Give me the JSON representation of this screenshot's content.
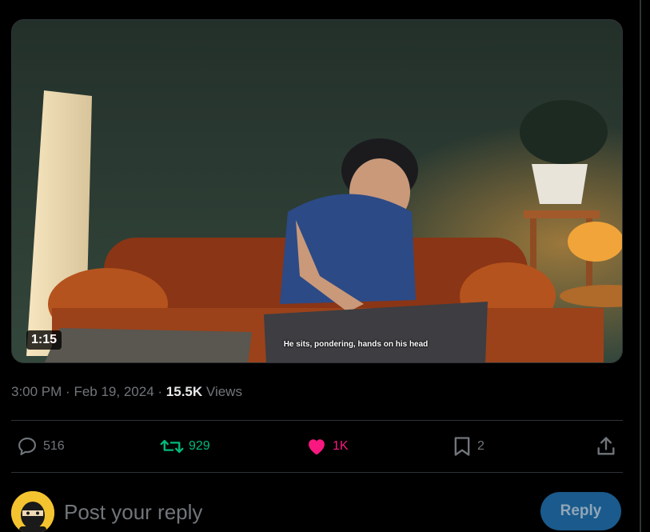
{
  "video": {
    "duration": "1:15",
    "caption": "He sits, pondering, hands on his head"
  },
  "meta": {
    "time": "3:00 PM",
    "separator1": "·",
    "date": "Feb 19, 2024",
    "separator2": "·",
    "views_count": "15.5K",
    "views_label": "Views"
  },
  "actions": {
    "replies": "516",
    "reposts": "929",
    "likes": "1K",
    "bookmarks": "2"
  },
  "composer": {
    "placeholder": "Post your reply",
    "reply_label": "Reply"
  },
  "colors": {
    "background": "#000000",
    "text_secondary": "#71767b",
    "repost_green": "#00ba7c",
    "like_pink": "#f91880",
    "reply_button": "#1a5a8c"
  },
  "icons": [
    "reply-icon",
    "repost-icon",
    "like-icon",
    "bookmark-icon",
    "share-icon",
    "play-duration-badge"
  ]
}
